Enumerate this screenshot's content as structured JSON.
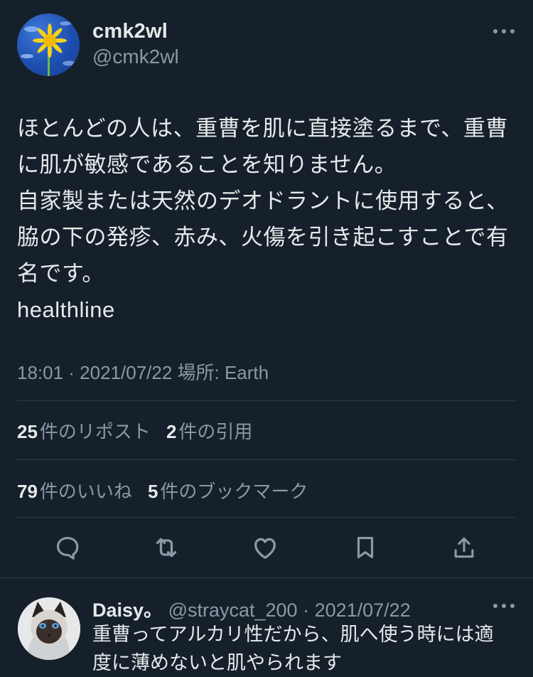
{
  "tweet": {
    "display_name": "cmk2wl",
    "handle": "@cmk2wl",
    "text": "ほとんどの人は、重曹を肌に直接塗るまで、重曹\nに肌が敏感であることを知りません。\n自家製または天然のデオドラントに使用すると、\n脇の下の発疹、赤み、火傷を引き起こすことで有\n名です。\nhealthline",
    "meta": "18:01 · 2021/07/22 場所: Earth",
    "reposts_count": "25",
    "reposts_label": "件のリポスト",
    "quotes_count": "2",
    "quotes_label": "件の引用",
    "likes_count": "79",
    "likes_label": "件のいいね",
    "bookmarks_count": "5",
    "bookmarks_label": "件のブックマーク"
  },
  "reply": {
    "display_name": "Daisy。",
    "handle": "@straycat_200",
    "dot": " · ",
    "date": "2021/07/22",
    "text": "重曹ってアルカリ性だから、肌へ使う時には適\n度に薄めないと肌やられます"
  },
  "icons": {
    "more": "more-horizontal-icon",
    "reply": "reply-bubble-icon",
    "repost": "repost-arrows-icon",
    "like": "heart-icon",
    "bookmark": "bookmark-icon",
    "share": "share-upload-icon"
  },
  "colors": {
    "background": "#15202b",
    "text": "#e7e9ea",
    "muted": "#8b98a5",
    "divider": "#2f3b47"
  }
}
